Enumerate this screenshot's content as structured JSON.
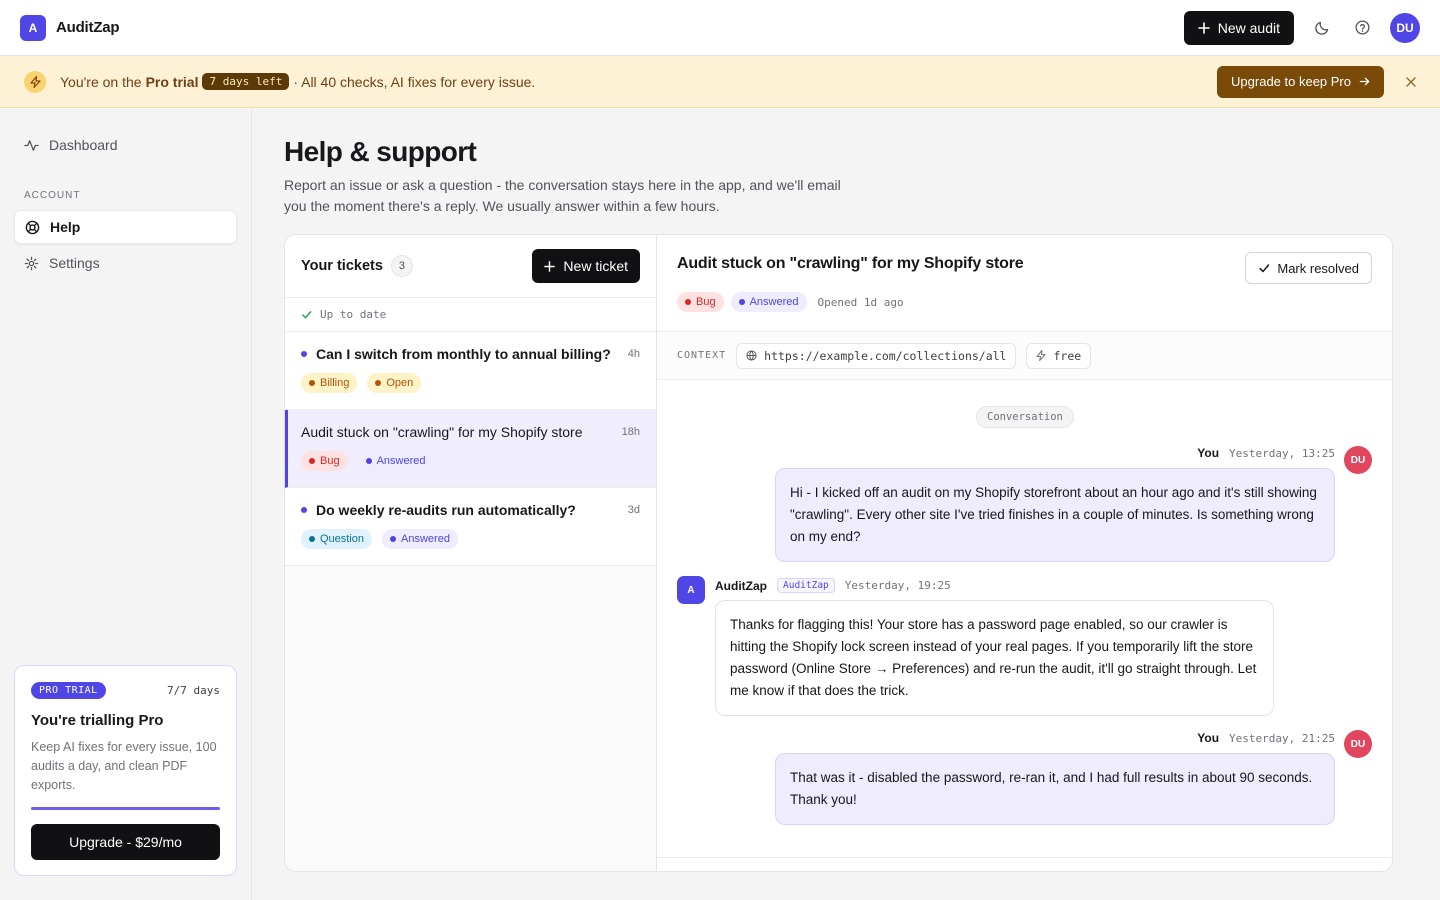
{
  "app": {
    "logo_letter": "A",
    "name": "AuditZap"
  },
  "topbar": {
    "new_audit_label": "New audit",
    "avatar_initials": "DU"
  },
  "banner": {
    "prefix": "You're on the ",
    "plan": "Pro trial",
    "days_left": "7 days left",
    "suffix": "· All 40 checks, AI fixes for every issue.",
    "upgrade_label": "Upgrade to keep Pro"
  },
  "sidebar": {
    "dashboard_label": "Dashboard",
    "section_label": "ACCOUNT",
    "help_label": "Help",
    "settings_label": "Settings",
    "trial_card": {
      "pill": "PRO TRIAL",
      "days": "7/7 days",
      "title": "You're trialling Pro",
      "description": "Keep AI fixes for every issue, 100 audits a day, and clean PDF exports.",
      "progress": 1.0,
      "button_label": "Upgrade - $29/mo"
    }
  },
  "page": {
    "title": "Help & support",
    "description": "Report an issue or ask a question - the conversation stays here in the app, and we'll email you the moment there's a reply. We usually answer within a few hours."
  },
  "tickets": {
    "title": "Your tickets",
    "count": "3",
    "new_ticket_label": "New ticket",
    "status": "Up to date",
    "items": [
      {
        "title": "Can I switch from monthly to annual billing?",
        "age": "4h",
        "unread": true,
        "tags": [
          {
            "label": "Billing",
            "kind": "billing"
          },
          {
            "label": "Open",
            "kind": "open"
          }
        ]
      },
      {
        "title": "Audit stuck on \"crawling\" for my Shopify store",
        "age": "18h",
        "unread": false,
        "tags": [
          {
            "label": "Bug",
            "kind": "bug"
          },
          {
            "label": "Answered",
            "kind": "answered"
          }
        ]
      },
      {
        "title": "Do weekly re-audits run automatically?",
        "age": "3d",
        "unread": true,
        "tags": [
          {
            "label": "Question",
            "kind": "question"
          },
          {
            "label": "Answered",
            "kind": "answered"
          }
        ]
      }
    ]
  },
  "conversation": {
    "title": "Audit stuck on \"crawling\" for my Shopify store",
    "resolve_label": "Mark resolved",
    "tag_bug": "Bug",
    "tag_answered": "Answered",
    "opened": "Opened 1d ago",
    "context_label": "CONTEXT",
    "context_url": "https://example.com/collections/all",
    "context_plan": "free",
    "divider": "Conversation",
    "messages": [
      {
        "who": "You",
        "when": "Yesterday, 13:25",
        "initials": "DU",
        "text": "Hi - I kicked off an audit on my Shopify storefront about an hour ago and it's still showing \"crawling\". Every other site I've tried finishes in a couple of minutes. Is something wrong on my end?"
      },
      {
        "who": "AuditZap",
        "badge": "AuditZap",
        "when": "Yesterday, 19:25",
        "initials": "A",
        "text": "Thanks for flagging this! Your store has a password page enabled, so our crawler is hitting the Shopify lock screen instead of your real pages. If you temporarily lift the store password (Online Store → Preferences) and re-run the audit, it'll go straight through. Let me know if that does the trick."
      },
      {
        "who": "You",
        "when": "Yesterday, 21:25",
        "initials": "DU",
        "text": "That was it - disabled the password, re-ran it, and I had full results in about 90 seconds. Thank you!"
      }
    ]
  },
  "colors": {
    "accent": "#4f46e5",
    "billing": "#b45309",
    "billing_bg": "#fef3c7",
    "open": "#b45309",
    "open_bg": "#fef3c7",
    "bug": "#dc2626",
    "bug_bg": "#fee2e2",
    "answered": "#4f46e5",
    "answered_bg": "#eeecfd",
    "question": "#0e7490",
    "question_bg": "#e0f2fe"
  }
}
